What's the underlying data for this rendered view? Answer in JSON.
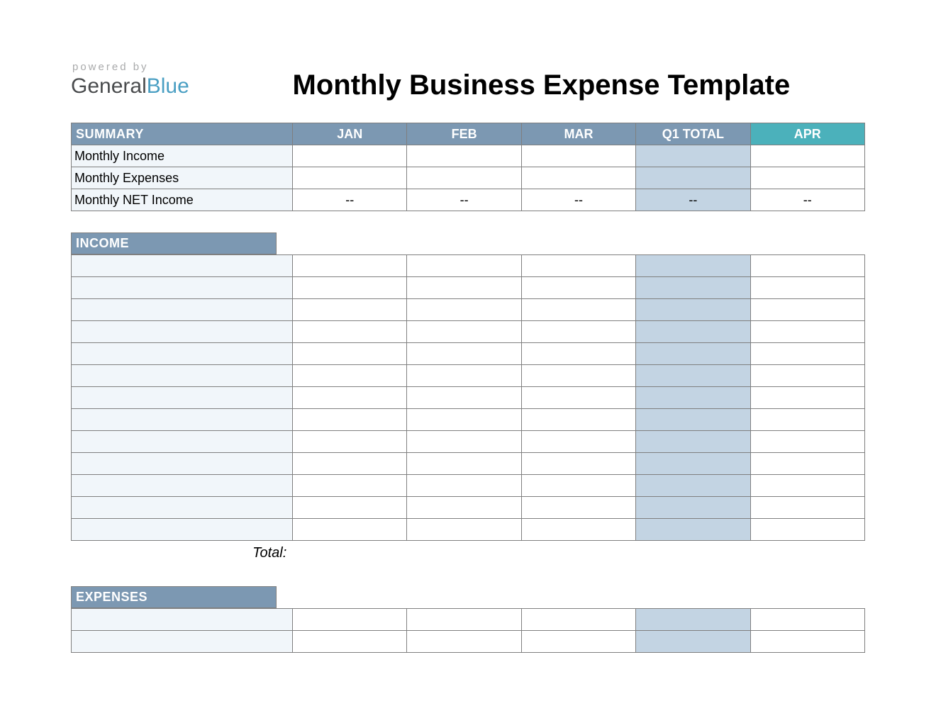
{
  "logo": {
    "powered_by": "powered by",
    "name_general": "General",
    "name_blue": "Blue"
  },
  "title": "Monthly Business Expense Template",
  "summary": {
    "header": "SUMMARY",
    "columns": [
      "JAN",
      "FEB",
      "MAR",
      "Q1 TOTAL",
      "APR"
    ],
    "rows": [
      {
        "label": "Monthly Income",
        "values": [
          "",
          "",
          "",
          "",
          ""
        ]
      },
      {
        "label": "Monthly Expenses",
        "values": [
          "",
          "",
          "",
          "",
          ""
        ]
      },
      {
        "label": "Monthly NET Income",
        "values": [
          "--",
          "--",
          "--",
          "--",
          "--"
        ]
      }
    ]
  },
  "income": {
    "header": "INCOME",
    "row_count": 13,
    "total_label": "Total:"
  },
  "expenses": {
    "header": "EXPENSES",
    "row_count": 2
  },
  "colors": {
    "header_blue": "#7c98b2",
    "header_teal": "#4bb1bb",
    "label_bg": "#f1f6fa",
    "q1_bg": "#c3d4e3",
    "border": "#7f7f7f"
  }
}
